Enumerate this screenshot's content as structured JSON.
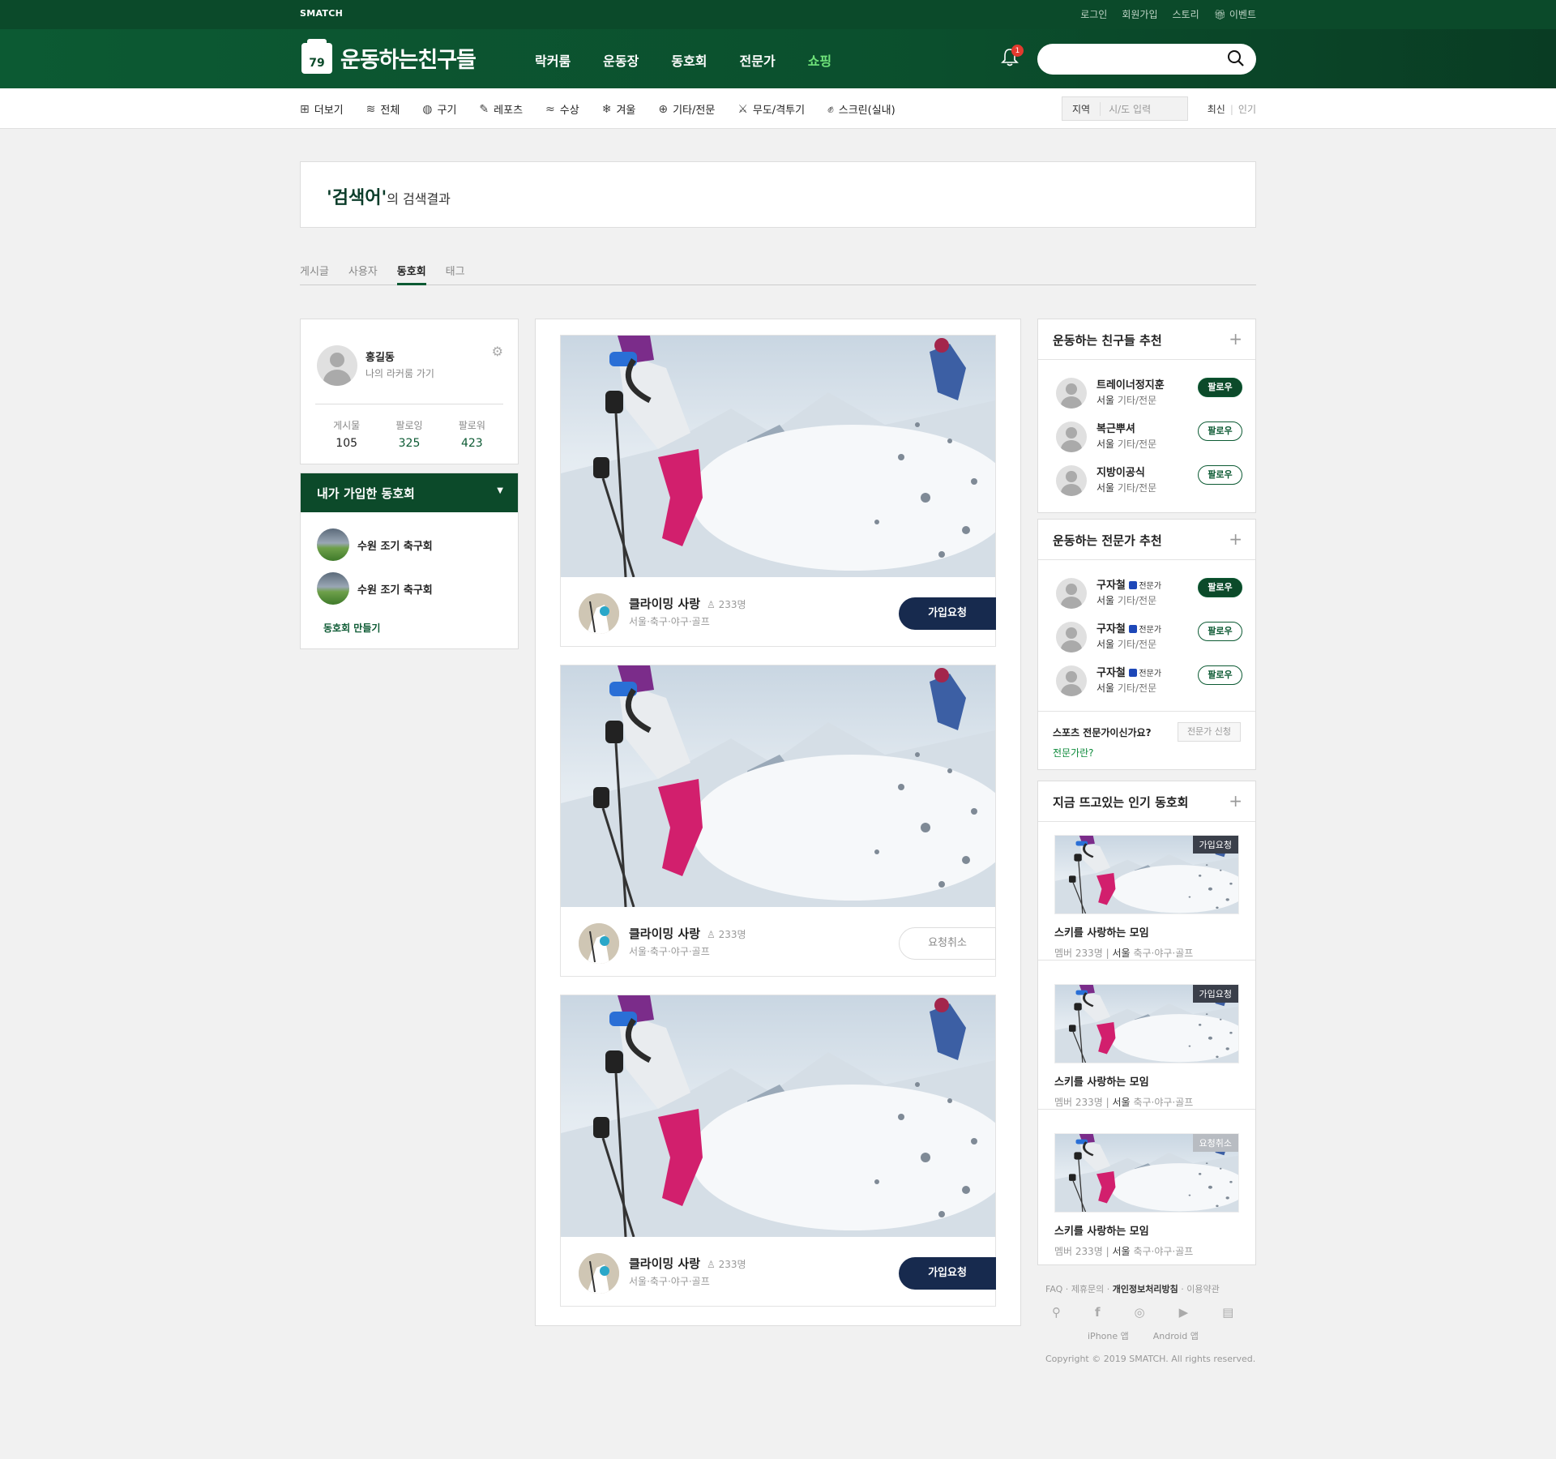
{
  "topbar": {
    "brand": "SMATCH",
    "links": [
      "로그인",
      "회원가입",
      "스토리",
      "이벤트"
    ]
  },
  "header": {
    "logo_number": "79",
    "logo_name": "운동하는친구들",
    "nav": [
      "락커룸",
      "운동장",
      "동호회",
      "전문가",
      "쇼핑"
    ],
    "notification_count": "1",
    "search_placeholder": ""
  },
  "categories": {
    "items": [
      {
        "label": "더보기",
        "icon": "plus-box-icon"
      },
      {
        "label": "전체",
        "icon": "layers-icon"
      },
      {
        "label": "구기",
        "icon": "ball-icon"
      },
      {
        "label": "레포츠",
        "icon": "leisure-icon"
      },
      {
        "label": "수상",
        "icon": "water-icon"
      },
      {
        "label": "겨울",
        "icon": "snowflake-icon"
      },
      {
        "label": "기타/전문",
        "icon": "globe-icon"
      },
      {
        "label": "무도/격투기",
        "icon": "swords-icon"
      },
      {
        "label": "스크린(실내)",
        "icon": "glove-icon"
      }
    ],
    "region_label": "지역",
    "region_placeholder": "시/도 입력",
    "sort_latest": "최신",
    "sort_popular": "인기"
  },
  "result": {
    "query": "'검색어'",
    "suffix": "의 검색결과",
    "tabs": [
      "게시글",
      "사용자",
      "동호회",
      "태그"
    ],
    "active_tab": "동호회"
  },
  "profile": {
    "name": "홍길동",
    "sub": "나의 라커룸 가기",
    "stats": [
      {
        "label": "게시물",
        "value": "105"
      },
      {
        "label": "팔로잉",
        "value": "325"
      },
      {
        "label": "팔로워",
        "value": "423"
      }
    ]
  },
  "my_clubs": {
    "title": "내가 가입한 동호회",
    "items": [
      "수원 조기 축구회",
      "수원 조기 축구회"
    ],
    "make": "동호회 만들기"
  },
  "clubs": [
    {
      "title": "클라이밍 사랑",
      "count": "233명",
      "tags": "서울·축구·야구·골프",
      "button": "가입요청",
      "state": "join"
    },
    {
      "title": "클라이밍 사랑",
      "count": "233명",
      "tags": "서울·축구·야구·골프",
      "button": "요청취소",
      "state": "cancel"
    },
    {
      "title": "클라이밍 사랑",
      "count": "233명",
      "tags": "서울·축구·야구·골프",
      "button": "가입요청",
      "state": "join"
    }
  ],
  "friends": {
    "title": "운동하는 친구들 추천",
    "items": [
      {
        "name": "트레이너정지훈",
        "city": "서울",
        "cat": "기타/전문",
        "follow": "팔로우",
        "active": true
      },
      {
        "name": "복근뿌셔",
        "city": "서울",
        "cat": "기타/전문",
        "follow": "팔로우",
        "active": false
      },
      {
        "name": "지방이공식",
        "city": "서울",
        "cat": "기타/전문",
        "follow": "팔로우",
        "active": false
      }
    ]
  },
  "experts": {
    "title": "운동하는 전문가 추천",
    "badge": "전문가",
    "items": [
      {
        "name": "구자철",
        "city": "서울",
        "cat": "기타/전문",
        "follow": "팔로우",
        "active": true
      },
      {
        "name": "구자철",
        "city": "서울",
        "cat": "기타/전문",
        "follow": "팔로우",
        "active": false
      },
      {
        "name": "구자철",
        "city": "서울",
        "cat": "기타/전문",
        "follow": "팔로우",
        "active": false
      }
    ],
    "question": "스포츠 전문가이신가요?",
    "what": "전문가란?",
    "apply": "전문가 신청"
  },
  "hot": {
    "title": "지금 뜨고있는 인기 동호회",
    "items": [
      {
        "label": "가입요청",
        "title": "스키를 사랑하는 모임",
        "members": "멤버 233명",
        "city": "서울",
        "tags": "축구·야구·골프"
      },
      {
        "label": "가입요청",
        "title": "스키를 사랑하는 모임",
        "members": "멤버 233명",
        "city": "서울",
        "tags": "축구·야구·골프"
      },
      {
        "label": "요청취소",
        "title": "스키를 사랑하는 모임",
        "members": "멤버 233명",
        "city": "서울",
        "tags": "축구·야구·골프"
      }
    ]
  },
  "footer": {
    "links": [
      "FAQ",
      "제휴문의",
      "개인정보처리방침",
      "이용약관"
    ],
    "apps": [
      "iPhone 앱",
      "Android 앱"
    ],
    "copyright": "Copyright © 2019 SMATCH. All rights reserved."
  },
  "colors": {
    "primary": "#0c5a33",
    "join_button": "#172a4e",
    "accent_green": "#6fe27a",
    "alert": "#e23a2e"
  }
}
